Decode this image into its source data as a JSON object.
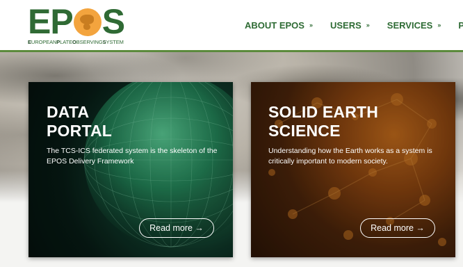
{
  "logo": {
    "word_pre": "EP",
    "word_post": "S",
    "tagline_parts": [
      "E",
      "UROPEAN",
      "P",
      "LATE",
      "O",
      "BSERVING",
      "S",
      "YSTEM"
    ]
  },
  "nav": {
    "items": [
      {
        "label": "ABOUT EPOS",
        "chevron": "»"
      },
      {
        "label": "USERS",
        "chevron": "»"
      },
      {
        "label": "SERVICES",
        "chevron": "»"
      },
      {
        "label": "PR"
      }
    ]
  },
  "cards": [
    {
      "title_line1": "DATA",
      "title_line2": "PORTAL",
      "description": "The TCS-ICS federated system is the skeleton of the EPOS Delivery Framework",
      "button": "Read more →"
    },
    {
      "title_line1": "SOLID EARTH",
      "title_line2": "SCIENCE",
      "description": "Understanding how the Earth works as a system is critically important to modern society.",
      "button": "Read more →"
    }
  ],
  "colors": {
    "brand_green": "#2f6a34",
    "logo_orange": "#f3a43e",
    "header_rule": "#5b8a3c"
  },
  "icons": [
    "globe-logo-icon",
    "chevron-double-down-icon",
    "arrow-right-icon"
  ]
}
